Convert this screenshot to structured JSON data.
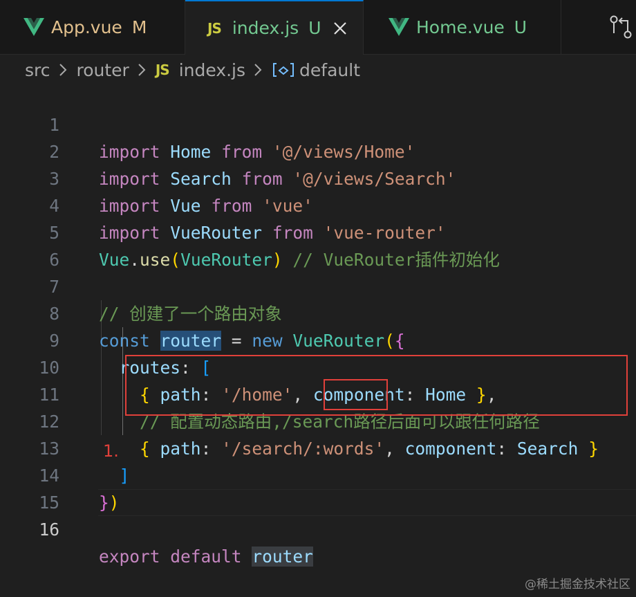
{
  "tabs": [
    {
      "name": "App.vue",
      "status": "M",
      "type": "vue"
    },
    {
      "name": "index.js",
      "status": "U",
      "type": "js",
      "active": true
    },
    {
      "name": "Home.vue",
      "status": "U",
      "type": "vue"
    }
  ],
  "breadcrumb": {
    "items": [
      "src",
      "router",
      "index.js",
      "default"
    ],
    "js_badge": "JS"
  },
  "editor": {
    "line_numbers": [
      "1",
      "2",
      "3",
      "4",
      "5",
      "6",
      "7",
      "8",
      "9",
      "10",
      "11",
      "12",
      "13",
      "14",
      "15",
      "16"
    ],
    "active_line": "16",
    "annotation_label": "1.",
    "l1": {
      "kw1": "import",
      "id": "Home",
      "kw2": "from",
      "str": "'@/views/Home'"
    },
    "l2": {
      "kw1": "import",
      "id": "Search",
      "kw2": "from",
      "str": "'@/views/Search'"
    },
    "l3": {
      "kw1": "import",
      "id": "Vue",
      "kw2": "from",
      "str": "'vue'"
    },
    "l4": {
      "kw1": "import",
      "id": "VueRouter",
      "kw2": "from",
      "str": "'vue-router'"
    },
    "l5": {
      "obj": "Vue",
      "dot": ".",
      "fn": "use",
      "po": "(",
      "arg": "VueRouter",
      "pc": ")",
      "cmt": "// VueRouter插件初始化"
    },
    "l7": {
      "cmt": "// 创建了一个路由对象"
    },
    "l8": {
      "kw": "const",
      "id": "router",
      "eq": " = ",
      "new": "new",
      "cls": "VueRouter",
      "po": "(",
      "bo": "{"
    },
    "l9": {
      "prop": "routes",
      "colon": ": ",
      "bo": "["
    },
    "l10": {
      "bo": "{",
      "k1": "path",
      "c1": ": ",
      "v1": "'/home'",
      "comma": ", ",
      "k2": "component",
      "c2": ": ",
      "v2": "Home",
      "bc": "}",
      "end": ","
    },
    "l11": {
      "cmt": "// 配置动态路由,/search路径后面可以跟任何路径"
    },
    "l12": {
      "bo": "{",
      "k1": "path",
      "c1": ": ",
      "v1a": "'/search/",
      "v1b": ":words",
      "v1c": "'",
      "comma": ", ",
      "k2": "component",
      "c2": ": ",
      "v2": "Search",
      "bc": "}"
    },
    "l13": {
      "bc": "]"
    },
    "l14": {
      "bc": "}",
      "pc": ")"
    },
    "l16": {
      "kw1": "export",
      "kw2": "default",
      "id": "router"
    }
  },
  "watermark": "@稀土掘金技术社区",
  "colors": {
    "annotation": "#e0403a",
    "accent": "#0078d4"
  }
}
